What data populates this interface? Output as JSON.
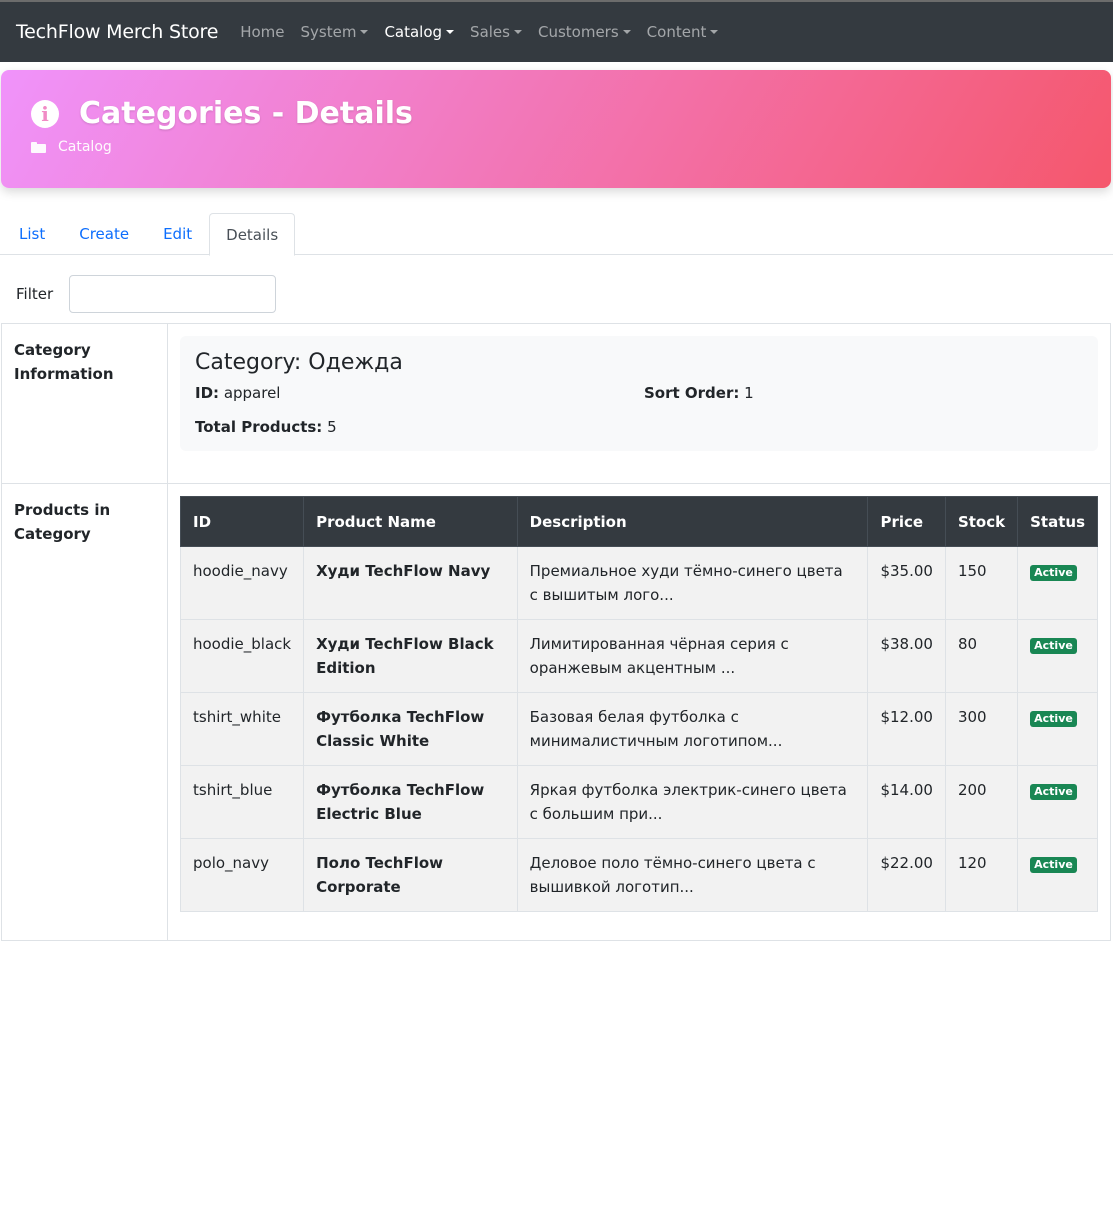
{
  "navbar": {
    "brand": "TechFlow Merch Store",
    "items": [
      {
        "label": "Home"
      },
      {
        "label": "System"
      },
      {
        "label": "Catalog"
      },
      {
        "label": "Sales"
      },
      {
        "label": "Customers"
      },
      {
        "label": "Content"
      }
    ]
  },
  "header": {
    "title": "Categories - Details",
    "breadcrumb": "Catalog",
    "icon": "info-circle-icon",
    "gradient": [
      "#f093fb",
      "#f5576c"
    ]
  },
  "tabs": [
    "List",
    "Create",
    "Edit",
    "Details"
  ],
  "active_tab": "Details",
  "filter": {
    "label": "Filter",
    "value": ""
  },
  "category_section": {
    "label": "Category Information",
    "heading": "Category: Одежда",
    "id_label": "ID:",
    "id_value": "apparel",
    "sort_label": "Sort Order:",
    "sort_value": "1",
    "total_label": "Total Products:",
    "total_value": "5"
  },
  "products_section": {
    "label": "Products in Category",
    "columns": [
      "ID",
      "Product Name",
      "Description",
      "Price",
      "Stock",
      "Status"
    ],
    "rows": [
      {
        "id": "hoodie_navy",
        "name": "Худи TechFlow Navy",
        "description": "Премиальное худи тёмно-синего цвета с вышитым лого...",
        "price": "$35.00",
        "stock": "150",
        "status": "Active"
      },
      {
        "id": "hoodie_black",
        "name": "Худи TechFlow Black Edition",
        "description": "Лимитированная чёрная серия с оранжевым акцентным ...",
        "price": "$38.00",
        "stock": "80",
        "status": "Active"
      },
      {
        "id": "tshirt_white",
        "name": "Футболка TechFlow Classic White",
        "description": "Базовая белая футболка с минималистичным логотипом...",
        "price": "$12.00",
        "stock": "300",
        "status": "Active"
      },
      {
        "id": "tshirt_blue",
        "name": "Футболка TechFlow Electric Blue",
        "description": "Яркая футболка электрик-синего цвета с большим при...",
        "price": "$14.00",
        "stock": "200",
        "status": "Active"
      },
      {
        "id": "polo_navy",
        "name": "Поло TechFlow Corporate",
        "description": "Деловое поло тёмно-синего цвета с вышивкой логотип...",
        "price": "$22.00",
        "stock": "120",
        "status": "Active"
      }
    ]
  },
  "colors": {
    "status_active": "#198754",
    "navbar": "#343a40",
    "link": "#0d6efd"
  }
}
